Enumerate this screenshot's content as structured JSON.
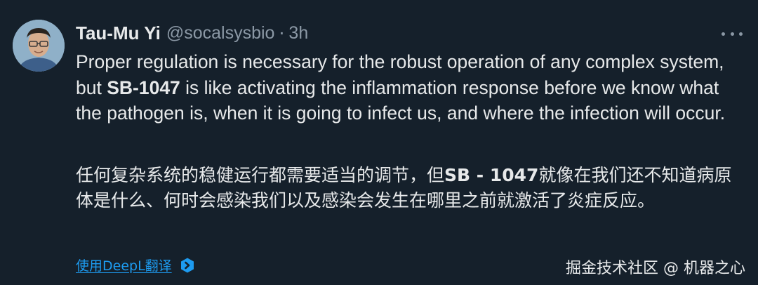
{
  "author": {
    "name": "Tau-Mu Yi",
    "handle": "@socalsysbio",
    "separator": "·",
    "time": "3h"
  },
  "tweet": {
    "text_before": "Proper regulation is necessary for the robust operation of any complex system, but ",
    "bold_term": "SB-1047",
    "text_after": " is like activating the inflammation response before we know what the pathogen is, when it is going to infect us, and where the infection will occur."
  },
  "translation_text": {
    "text_before": "任何复杂系统的稳健运行都需要适当的调节，但",
    "bold_term": "SB - 1047",
    "text_after": "就像在我们还不知道病原体是什么、何时会感染我们以及感染会发生在哪里之前就激活了炎症反应。"
  },
  "translate_link": {
    "label": "使用DeepL翻译",
    "icon": "deepl-icon"
  },
  "watermark": "掘金技术社区 @ 机器之心",
  "colors": {
    "background": "#15202b",
    "text": "#e7e9ea",
    "secondary": "#8b98a5",
    "link": "#1d9bf0"
  }
}
